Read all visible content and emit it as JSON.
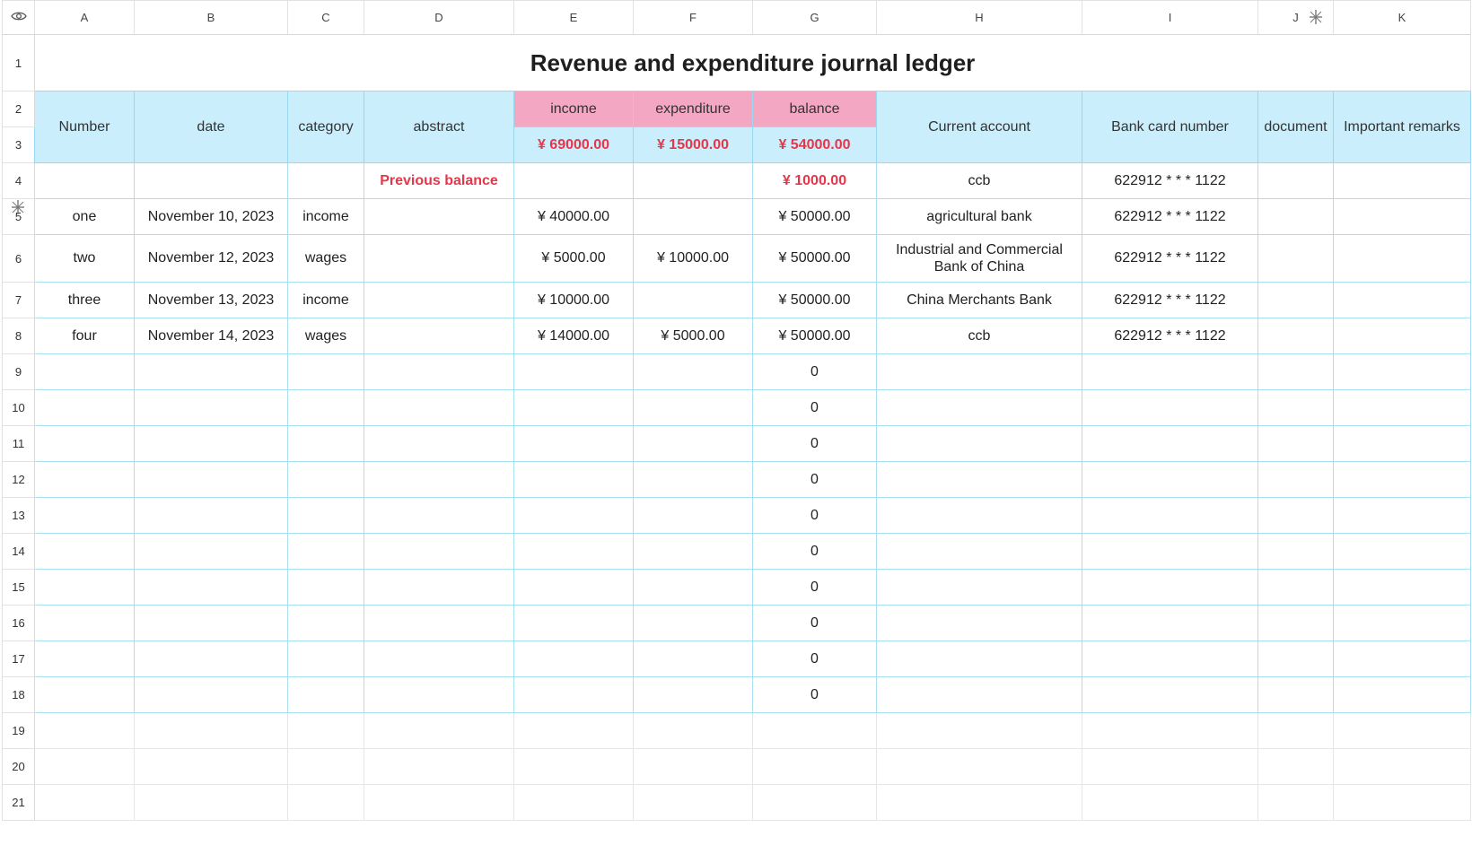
{
  "columns": [
    "A",
    "B",
    "C",
    "D",
    "E",
    "F",
    "G",
    "H",
    "I",
    "J",
    "K"
  ],
  "rows": [
    "1",
    "2",
    "3",
    "4",
    "5",
    "6",
    "7",
    "8",
    "9",
    "10",
    "11",
    "12",
    "13",
    "14",
    "15",
    "16",
    "17",
    "18",
    "19",
    "20",
    "21"
  ],
  "title": "Revenue and expenditure journal ledger",
  "header": {
    "number": "Number",
    "date": "date",
    "category": "category",
    "abstract": "abstract",
    "income": "income",
    "expenditure": "expenditure",
    "balance": "balance",
    "current_account": "Current account",
    "bank_card": "Bank card number",
    "document": "document",
    "remarks": "Important remarks"
  },
  "totals": {
    "income": "¥ 69000.00",
    "expenditure": "¥ 15000.00",
    "balance": "¥ 54000.00"
  },
  "previous": {
    "label": "Previous balance",
    "balance": "¥ 1000.00",
    "account": "ccb",
    "card": "622912 * * * 1122"
  },
  "entries": [
    {
      "number": "one",
      "date": "November 10, 2023",
      "category": "income",
      "income": "¥ 40000.00",
      "expenditure": "",
      "balance": "¥ 50000.00",
      "account": "agricultural bank",
      "card": "622912 * * * 1122"
    },
    {
      "number": "two",
      "date": "November 12, 2023",
      "category": "wages",
      "income": "¥ 5000.00",
      "expenditure": "¥ 10000.00",
      "balance": "¥ 50000.00",
      "account": "Industrial and Commercial Bank of China",
      "card": "622912 * * * 1122"
    },
    {
      "number": "three",
      "date": "November 13, 2023",
      "category": "income",
      "income": "¥ 10000.00",
      "expenditure": "",
      "balance": "¥ 50000.00",
      "account": "China Merchants Bank",
      "card": "622912 * * * 1122"
    },
    {
      "number": "four",
      "date": "November 14, 2023",
      "category": "wages",
      "income": "¥ 14000.00",
      "expenditure": "¥ 5000.00",
      "balance": "¥ 50000.00",
      "account": "ccb",
      "card": "622912 * * * 1122"
    }
  ],
  "empty_balances": [
    "0",
    "0",
    "0",
    "0",
    "0",
    "0",
    "0",
    "0",
    "0",
    "0"
  ],
  "icons": {
    "corner": "eye-icon",
    "resize": "resize-handle-icon"
  },
  "colors": {
    "header_bg": "#cbeefc",
    "header_pink": "#f4a7c2",
    "grid_blue": "#9ad8ef",
    "accent_red": "#e6374a"
  }
}
